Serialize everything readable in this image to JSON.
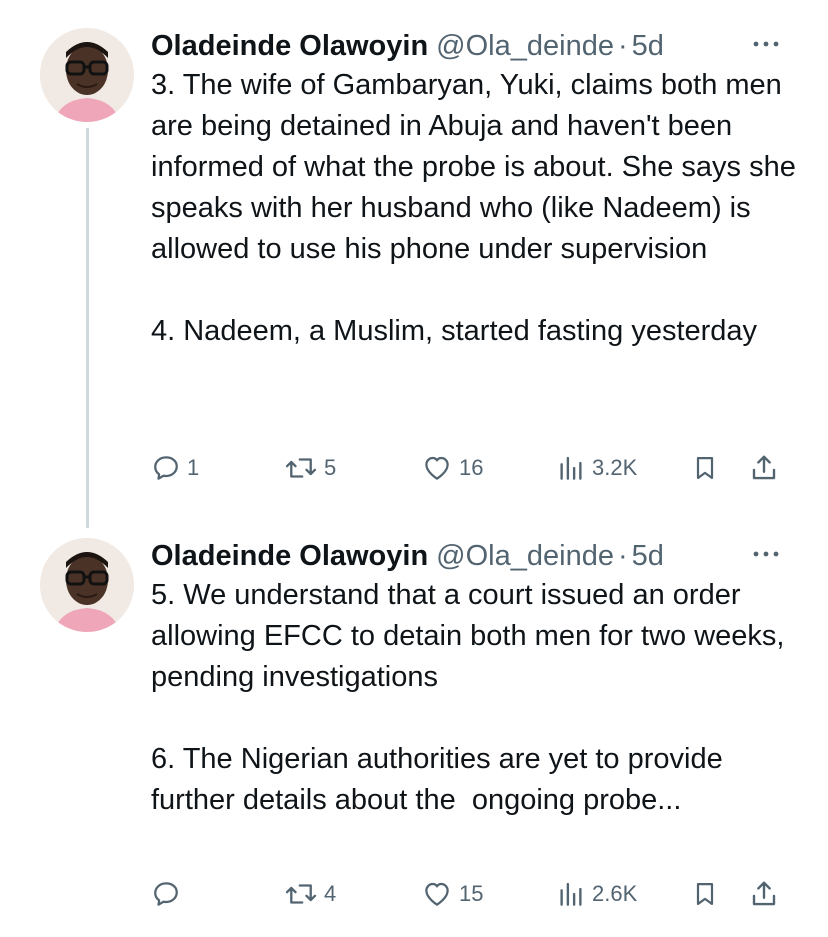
{
  "tweets": [
    {
      "author_name": "Oladeinde Olawoyin",
      "handle": "@Ola_deinde",
      "separator": "·",
      "time": "5d",
      "text": "3. The wife of Gambaryan, Yuki, claims both men are being detained in Abuja and haven't been informed of what the probe is about. She says she speaks with her husband who (like Nadeem) is allowed to use his phone under supervision\n\n4. Nadeem, a Muslim, started fasting yesterday",
      "replies": "1",
      "reposts": "5",
      "likes": "16",
      "views": "3.2K"
    },
    {
      "author_name": "Oladeinde Olawoyin",
      "handle": "@Ola_deinde",
      "separator": "·",
      "time": "5d",
      "text": "5. We understand that a court issued an order allowing EFCC to detain both men for two weeks, pending investigations\n\n6. The Nigerian authorities are yet to provide further details about the  ongoing probe...",
      "replies": "",
      "reposts": "4",
      "likes": "15",
      "views": "2.6K"
    }
  ],
  "icons": {
    "more": "more-dots-icon",
    "reply": "reply-icon",
    "repost": "repost-icon",
    "like": "like-icon",
    "views": "views-icon",
    "bookmark": "bookmark-icon",
    "share": "share-icon"
  },
  "colors": {
    "text": "#0f1419",
    "secondary": "#536471",
    "thread_line": "#cfd9de"
  }
}
